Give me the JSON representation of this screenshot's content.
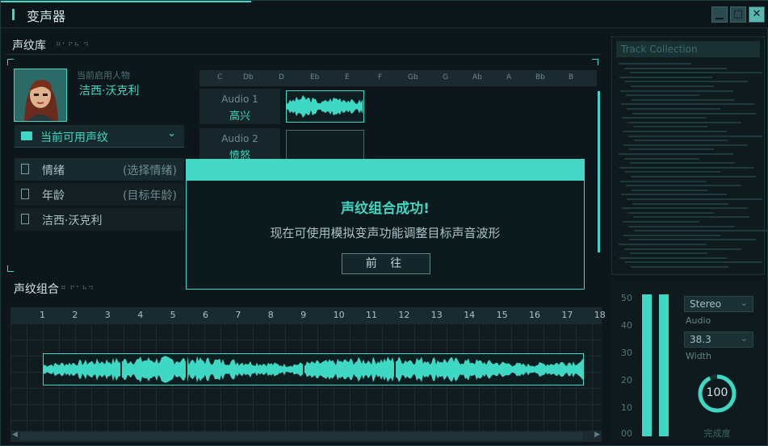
{
  "app": {
    "title": "变声器"
  },
  "library": {
    "title": "声纹库",
    "current_person_label": "当前启用人物",
    "current_person_name": "洁西·沃克利",
    "dropdown_label": "当前可用声纹",
    "rows": [
      {
        "key": "情绪",
        "value": "(选择情绪)"
      },
      {
        "key": "年龄",
        "value": "(目标年龄)"
      },
      {
        "key": "洁西·沃克利",
        "value": ""
      }
    ]
  },
  "keys": [
    "C",
    "Db",
    "D",
    "Eb",
    "E",
    "F",
    "Gb",
    "G",
    "Ab",
    "A",
    "Bb",
    "B"
  ],
  "tracks": [
    {
      "name": "Audio 1",
      "label": "高兴"
    },
    {
      "name": "Audio 2",
      "label": "愤怒"
    }
  ],
  "combination": {
    "title": "声纹组合",
    "ruler": [
      "1",
      "2",
      "3",
      "4",
      "5",
      "6",
      "7",
      "8",
      "9",
      "10",
      "11",
      "12",
      "13",
      "14",
      "15",
      "16",
      "17",
      "18"
    ]
  },
  "log": {
    "title": "Track Collection"
  },
  "meter": {
    "scale": [
      "50",
      "40",
      "30",
      "20",
      "10",
      "00"
    ],
    "channel_mode": "Stereo",
    "audio_label": "Audio",
    "width_value": "38.3",
    "width_label": "Width",
    "completion_value": "100",
    "completion_label": "完成度",
    "completion_fraction": 1.0
  },
  "modal": {
    "heading": "声纹组合成功!",
    "message": "现在可使用模拟变声功能调整目标声音波形",
    "button": "前 往"
  },
  "colors": {
    "accent": "#3fd8c4",
    "background": "#0d171b"
  }
}
